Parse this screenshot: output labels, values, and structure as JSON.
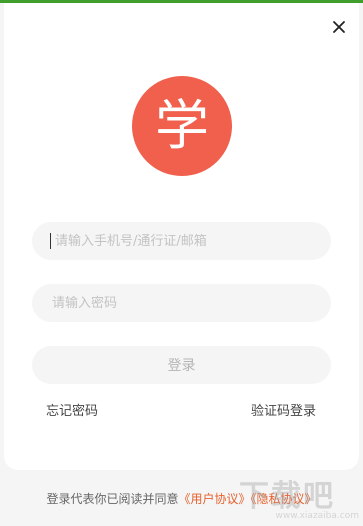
{
  "logo": {
    "char": "学",
    "color": "#f0604d"
  },
  "close": {
    "icon": "close-icon"
  },
  "form": {
    "account_placeholder": "请输入手机号/通行证/邮箱",
    "account_value": "",
    "password_placeholder": "请输入密码",
    "password_value": "",
    "login_label": "登录"
  },
  "links": {
    "forgot": "忘记密码",
    "sms_login": "验证码登录"
  },
  "agreement": {
    "prefix": "登录代表你已阅读并同意",
    "user": "《用户协议》",
    "privacy": "《隐私协议》"
  },
  "watermark": {
    "text": "下载吧",
    "url": "www.xiazaiba.com"
  },
  "colors": {
    "accent": "#e8612d",
    "top_strip": "#3f9e2c"
  }
}
